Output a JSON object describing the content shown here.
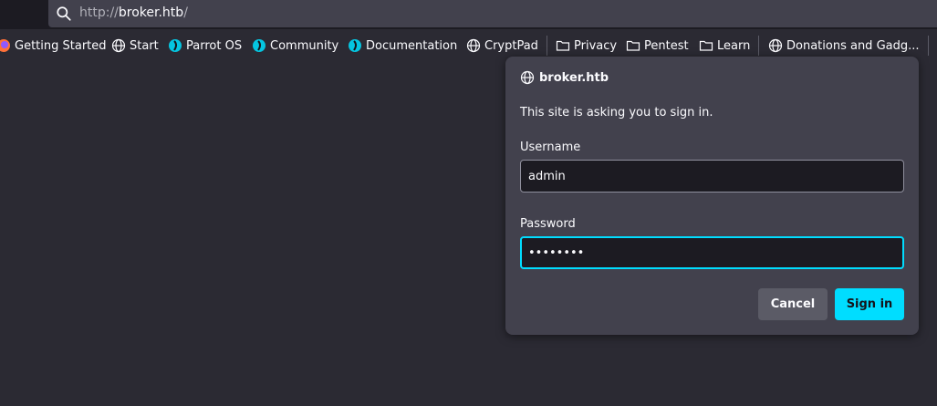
{
  "urlbar": {
    "protocol": "http://",
    "host": "broker.htb",
    "slash": "/"
  },
  "bookmarks": [
    {
      "label": "Getting Started",
      "icon": "firefox-icon"
    },
    {
      "label": "Start",
      "icon": "globe-icon"
    },
    {
      "label": "Parrot OS",
      "icon": "parrot-icon"
    },
    {
      "label": "Community",
      "icon": "parrot-icon"
    },
    {
      "label": "Documentation",
      "icon": "parrot-icon"
    },
    {
      "label": "CryptPad",
      "icon": "globe-icon"
    },
    {
      "label": "Privacy",
      "icon": "folder-icon"
    },
    {
      "label": "Pentest",
      "icon": "folder-icon"
    },
    {
      "label": "Learn",
      "icon": "folder-icon"
    },
    {
      "label": "Donations and Gadg...",
      "icon": "globe-icon"
    }
  ],
  "dialog": {
    "host": "broker.htb",
    "message": "This site is asking you to sign in.",
    "username_label": "Username",
    "username_value": "admin",
    "password_label": "Password",
    "password_value": "••••••••",
    "cancel_label": "Cancel",
    "signin_label": "Sign in"
  },
  "colors": {
    "accent": "#00ddff",
    "background": "#2b2a33",
    "dialog": "#42414d"
  }
}
